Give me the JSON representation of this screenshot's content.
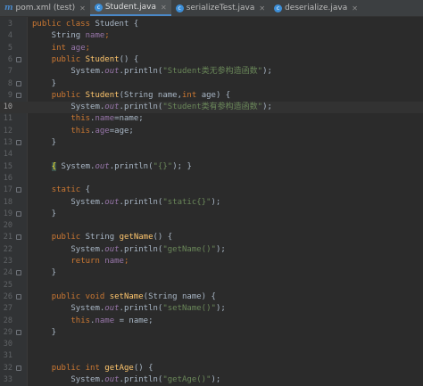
{
  "tabs": [
    {
      "label": "pom.xml (test)",
      "icon": "maven-icon",
      "active": false
    },
    {
      "label": "Student.java",
      "icon": "java-class-icon",
      "active": true
    },
    {
      "label": "serializeTest.java",
      "icon": "java-class-icon",
      "active": false
    },
    {
      "label": "deserialize.java",
      "icon": "java-class-icon",
      "active": false
    }
  ],
  "lines": [
    {
      "n": "3",
      "fold": false,
      "current": false,
      "tokens": [
        {
          "t": "public class ",
          "c": "kw"
        },
        {
          "t": "Student {",
          "c": ""
        }
      ]
    },
    {
      "n": "4",
      "fold": false,
      "current": false,
      "tokens": [
        {
          "t": "    String ",
          "c": ""
        },
        {
          "t": "name",
          "c": "fd"
        },
        {
          "t": ";",
          "c": "kw"
        }
      ]
    },
    {
      "n": "5",
      "fold": false,
      "current": false,
      "tokens": [
        {
          "t": "    ",
          "c": ""
        },
        {
          "t": "int ",
          "c": "kw"
        },
        {
          "t": "age",
          "c": "fd"
        },
        {
          "t": ";",
          "c": "kw"
        }
      ]
    },
    {
      "n": "6",
      "fold": true,
      "current": false,
      "tokens": [
        {
          "t": "    ",
          "c": ""
        },
        {
          "t": "public ",
          "c": "kw"
        },
        {
          "t": "Student",
          "c": "fn"
        },
        {
          "t": "() {",
          "c": ""
        }
      ]
    },
    {
      "n": "7",
      "fold": false,
      "current": false,
      "tokens": [
        {
          "t": "        System.",
          "c": ""
        },
        {
          "t": "out",
          "c": "it"
        },
        {
          "t": ".println(",
          "c": ""
        },
        {
          "t": "\"Student类无参构造函数\"",
          "c": "st"
        },
        {
          "t": ");",
          "c": ""
        }
      ]
    },
    {
      "n": "8",
      "fold": true,
      "current": false,
      "tokens": [
        {
          "t": "    }",
          "c": ""
        }
      ]
    },
    {
      "n": "9",
      "fold": true,
      "current": false,
      "tokens": [
        {
          "t": "    ",
          "c": ""
        },
        {
          "t": "public ",
          "c": "kw"
        },
        {
          "t": "Student",
          "c": "fn"
        },
        {
          "t": "(String name,",
          "c": ""
        },
        {
          "t": "int ",
          "c": "kw"
        },
        {
          "t": "age) {",
          "c": ""
        }
      ]
    },
    {
      "n": "10",
      "fold": false,
      "current": true,
      "tokens": [
        {
          "t": "        System.",
          "c": ""
        },
        {
          "t": "out",
          "c": "it"
        },
        {
          "t": ".println(",
          "c": ""
        },
        {
          "t": "\"Student类有参构造函数\"",
          "c": "st"
        },
        {
          "t": ");",
          "c": ""
        }
      ]
    },
    {
      "n": "11",
      "fold": false,
      "current": false,
      "tokens": [
        {
          "t": "        ",
          "c": ""
        },
        {
          "t": "this",
          "c": "kw"
        },
        {
          "t": ".",
          "c": ""
        },
        {
          "t": "name",
          "c": "fd"
        },
        {
          "t": "=name;",
          "c": ""
        }
      ]
    },
    {
      "n": "12",
      "fold": false,
      "current": false,
      "tokens": [
        {
          "t": "        ",
          "c": ""
        },
        {
          "t": "this",
          "c": "kw"
        },
        {
          "t": ".",
          "c": ""
        },
        {
          "t": "age",
          "c": "fd"
        },
        {
          "t": "=age;",
          "c": ""
        }
      ]
    },
    {
      "n": "13",
      "fold": true,
      "current": false,
      "tokens": [
        {
          "t": "    }",
          "c": ""
        }
      ]
    },
    {
      "n": "14",
      "fold": false,
      "current": false,
      "tokens": []
    },
    {
      "n": "15",
      "fold": false,
      "current": false,
      "tokens": [
        {
          "t": "    ",
          "c": ""
        },
        {
          "t": "{",
          "c": "br"
        },
        {
          "t": " System.",
          "c": ""
        },
        {
          "t": "out",
          "c": "it"
        },
        {
          "t": ".println(",
          "c": ""
        },
        {
          "t": "\"{}\"",
          "c": "st"
        },
        {
          "t": "); }",
          "c": ""
        }
      ]
    },
    {
      "n": "16",
      "fold": false,
      "current": false,
      "tokens": []
    },
    {
      "n": "17",
      "fold": true,
      "current": false,
      "tokens": [
        {
          "t": "    ",
          "c": ""
        },
        {
          "t": "static ",
          "c": "kw"
        },
        {
          "t": "{",
          "c": ""
        }
      ]
    },
    {
      "n": "18",
      "fold": false,
      "current": false,
      "tokens": [
        {
          "t": "        System.",
          "c": ""
        },
        {
          "t": "out",
          "c": "it"
        },
        {
          "t": ".println(",
          "c": ""
        },
        {
          "t": "\"static{}\"",
          "c": "st"
        },
        {
          "t": ");",
          "c": ""
        }
      ]
    },
    {
      "n": "19",
      "fold": true,
      "current": false,
      "tokens": [
        {
          "t": "    }",
          "c": ""
        }
      ]
    },
    {
      "n": "20",
      "fold": false,
      "current": false,
      "tokens": []
    },
    {
      "n": "21",
      "fold": true,
      "current": false,
      "tokens": [
        {
          "t": "    ",
          "c": ""
        },
        {
          "t": "public ",
          "c": "kw"
        },
        {
          "t": "String ",
          "c": ""
        },
        {
          "t": "getName",
          "c": "fn"
        },
        {
          "t": "() {",
          "c": ""
        }
      ]
    },
    {
      "n": "22",
      "fold": false,
      "current": false,
      "tokens": [
        {
          "t": "        System.",
          "c": ""
        },
        {
          "t": "out",
          "c": "it"
        },
        {
          "t": ".println(",
          "c": ""
        },
        {
          "t": "\"getName()\"",
          "c": "st"
        },
        {
          "t": ");",
          "c": ""
        }
      ]
    },
    {
      "n": "23",
      "fold": false,
      "current": false,
      "tokens": [
        {
          "t": "        ",
          "c": ""
        },
        {
          "t": "return ",
          "c": "kw"
        },
        {
          "t": "name",
          "c": "fd"
        },
        {
          "t": ";",
          "c": "kw"
        }
      ]
    },
    {
      "n": "24",
      "fold": true,
      "current": false,
      "tokens": [
        {
          "t": "    }",
          "c": ""
        }
      ]
    },
    {
      "n": "25",
      "fold": false,
      "current": false,
      "tokens": []
    },
    {
      "n": "26",
      "fold": true,
      "current": false,
      "tokens": [
        {
          "t": "    ",
          "c": ""
        },
        {
          "t": "public void ",
          "c": "kw"
        },
        {
          "t": "setName",
          "c": "fn"
        },
        {
          "t": "(String name) {",
          "c": ""
        }
      ]
    },
    {
      "n": "27",
      "fold": false,
      "current": false,
      "tokens": [
        {
          "t": "        System.",
          "c": ""
        },
        {
          "t": "out",
          "c": "it"
        },
        {
          "t": ".println(",
          "c": ""
        },
        {
          "t": "\"setName()\"",
          "c": "st"
        },
        {
          "t": ");",
          "c": ""
        }
      ]
    },
    {
      "n": "28",
      "fold": false,
      "current": false,
      "tokens": [
        {
          "t": "        ",
          "c": ""
        },
        {
          "t": "this",
          "c": "kw"
        },
        {
          "t": ".",
          "c": ""
        },
        {
          "t": "name",
          "c": "fd"
        },
        {
          "t": " = name;",
          "c": ""
        }
      ]
    },
    {
      "n": "29",
      "fold": true,
      "current": false,
      "tokens": [
        {
          "t": "    }",
          "c": ""
        }
      ]
    },
    {
      "n": "30",
      "fold": false,
      "current": false,
      "tokens": []
    },
    {
      "n": "31",
      "fold": false,
      "current": false,
      "tokens": []
    },
    {
      "n": "32",
      "fold": true,
      "current": false,
      "tokens": [
        {
          "t": "    ",
          "c": ""
        },
        {
          "t": "public int ",
          "c": "kw"
        },
        {
          "t": "getAge",
          "c": "fn"
        },
        {
          "t": "() {",
          "c": ""
        }
      ]
    },
    {
      "n": "33",
      "fold": false,
      "current": false,
      "tokens": [
        {
          "t": "        System.",
          "c": ""
        },
        {
          "t": "out",
          "c": "it"
        },
        {
          "t": ".println(",
          "c": ""
        },
        {
          "t": "\"getAge()\"",
          "c": "st"
        },
        {
          "t": ");",
          "c": ""
        }
      ]
    }
  ]
}
